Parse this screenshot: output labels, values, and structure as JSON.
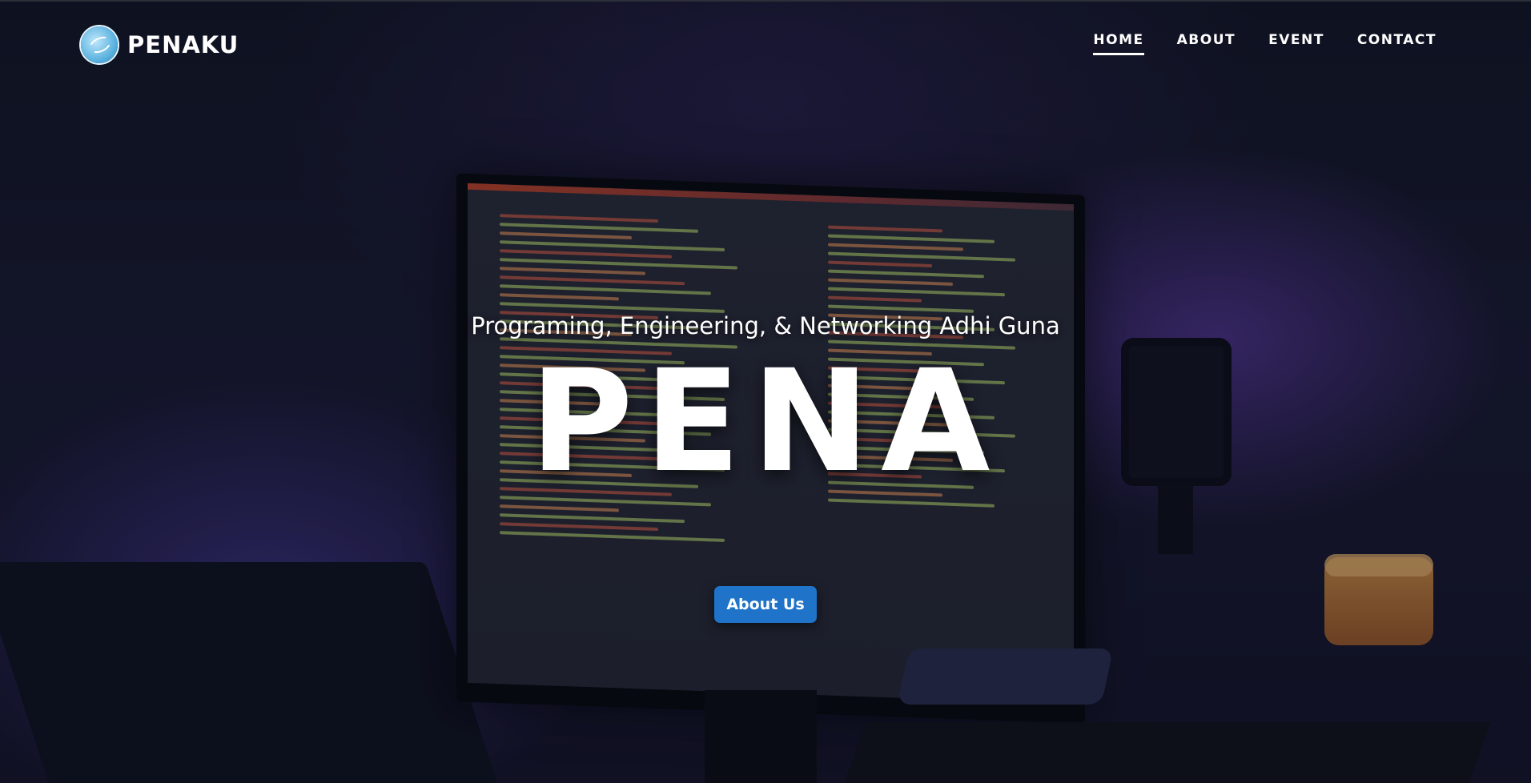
{
  "navbar": {
    "brand_name": "PENAKU",
    "links": [
      {
        "label": "HOME",
        "active": true
      },
      {
        "label": "ABOUT",
        "active": false
      },
      {
        "label": "EVENT",
        "active": false
      },
      {
        "label": "CONTACT",
        "active": false
      }
    ]
  },
  "hero": {
    "subtitle": "Programing, Engineering, & Networking Adhi Guna",
    "title": "PENA",
    "cta_label": "About Us"
  },
  "colors": {
    "accent": "#1f74c9",
    "text": "#ffffff"
  }
}
